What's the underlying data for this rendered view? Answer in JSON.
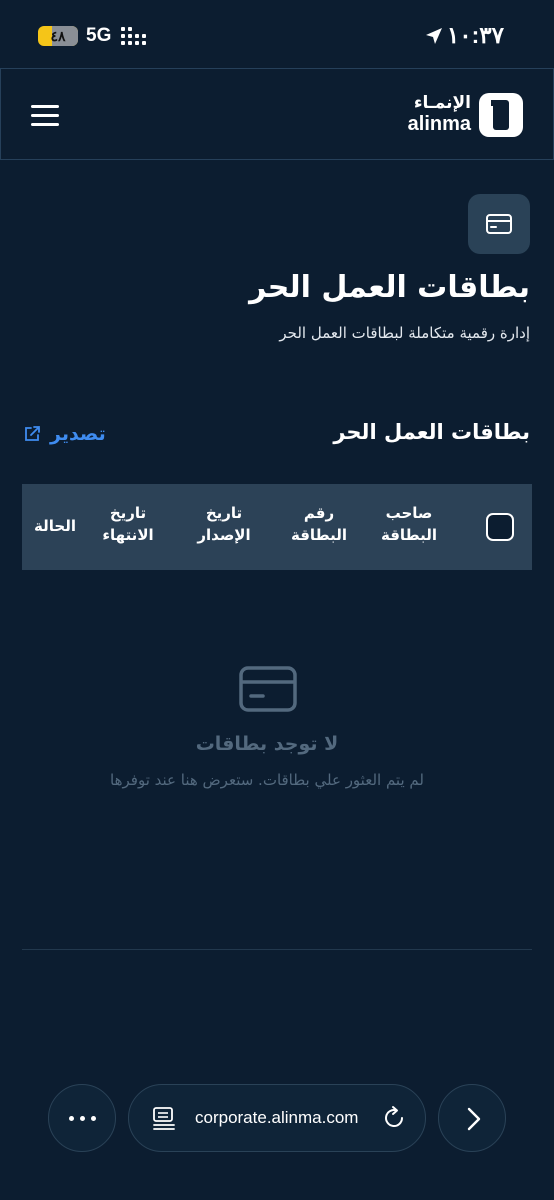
{
  "status_bar": {
    "battery_level": "٤٨",
    "network": "5G",
    "time": "١٠:٣٧",
    "battery_color": "#f5c518"
  },
  "header": {
    "logo_ar": "الإنمـاء",
    "logo_en": "alinma",
    "menu_icon": "hamburger-menu-icon"
  },
  "page": {
    "badge_icon": "credit-card-icon",
    "title": "بطاقات العمل الحر",
    "subtitle": "إدارة رقمية متكاملة لبطاقات العمل الحر"
  },
  "section": {
    "title": "بطاقات العمل الحر",
    "export_label": "تصدير",
    "export_icon": "external-link-icon",
    "accent_color": "#3f8cf0"
  },
  "table": {
    "columns": {
      "owner": [
        "صاحب",
        "البطاقة"
      ],
      "number": [
        "رقم",
        "البطاقة"
      ],
      "issue_date": [
        "تاريخ",
        "الإصدار"
      ],
      "expiry_date": [
        "تاريخ",
        "الانتهاء"
      ],
      "status": "الحالة"
    }
  },
  "empty_state": {
    "icon": "credit-card-icon",
    "title": "لا توجد بطاقات",
    "message": "لم يتم العثور علي بطاقات. ستعرض هنا عند توفرها"
  },
  "browser": {
    "url": "corporate.alinma.com",
    "more_icon": "ellipsis-icon",
    "reader_icon": "reader-mode-icon",
    "reload_icon": "reload-icon",
    "forward_icon": "chevron-right-icon"
  }
}
